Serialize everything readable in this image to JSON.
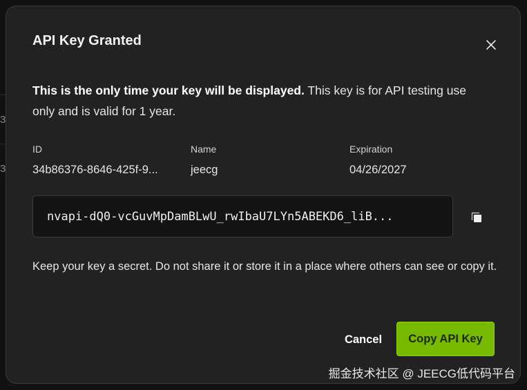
{
  "dialog": {
    "title": "API Key Granted",
    "notice_bold": "This is the only time your key will be displayed.",
    "notice_rest": " This key is for API testing use only and is valid for 1 year.",
    "fields": [
      {
        "label": "ID",
        "value": "34b86376-8646-425f-9..."
      },
      {
        "label": "Name",
        "value": "jeecg"
      },
      {
        "label": "Expiration",
        "value": "04/26/2027"
      }
    ],
    "api_key_display": "nvapi-dQ0-vcGuvMpDamBLwU_rwIbaU7LYn5ABEKD6_liB...",
    "secret_note": "Keep your key a secret. Do not share it or store it in a place where others can see or copy it.",
    "cancel_label": "Cancel",
    "copy_label": "Copy API Key"
  },
  "background": {
    "fragment_1": "3",
    "fragment_2": "3"
  },
  "watermark": "掘金技术社区 @ JEECG低代码平台",
  "colors": {
    "accent": "#76b900",
    "modal_bg": "#222222",
    "key_box_bg": "#141414"
  },
  "icons": {
    "close": "close-icon",
    "copy": "copy-icon"
  }
}
